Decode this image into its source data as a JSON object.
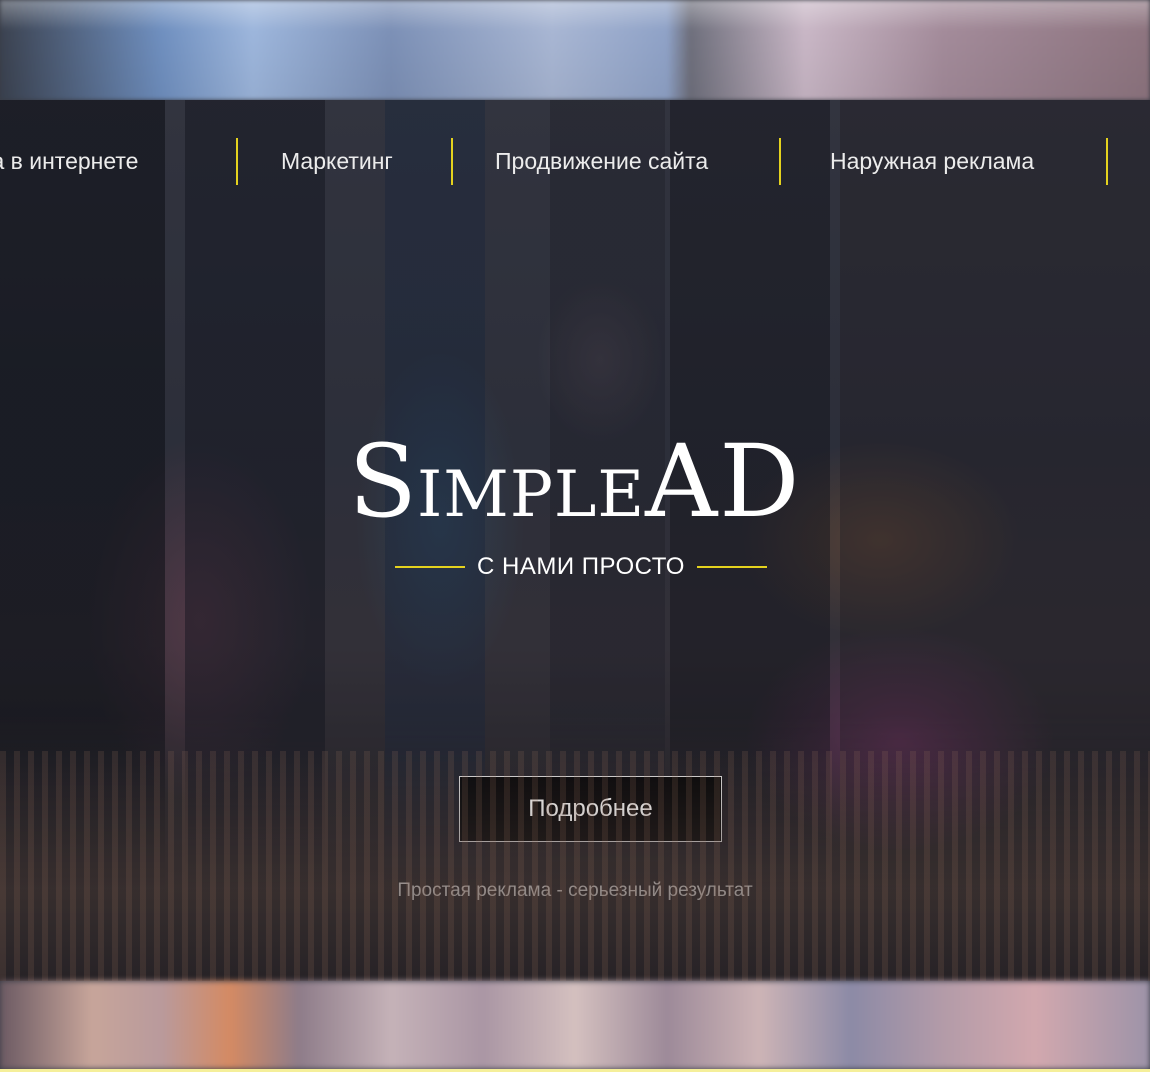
{
  "nav": {
    "items": [
      {
        "label": "Реклама в интернете"
      },
      {
        "label": "Маркетинг"
      },
      {
        "label": "Продвижение сайта"
      },
      {
        "label": "Наружная реклама"
      }
    ]
  },
  "hero": {
    "logo": {
      "part1_cap": "S",
      "part1_rest": "IMPLE",
      "part2": "AD"
    },
    "tagline": "С НАМИ ПРОСТО",
    "cta_label": "Подробнее",
    "slogan": "Простая реклама - серьезный результат"
  },
  "colors": {
    "accent": "#e4d21e",
    "text": "#ffffff",
    "button_bg": "#000000"
  }
}
